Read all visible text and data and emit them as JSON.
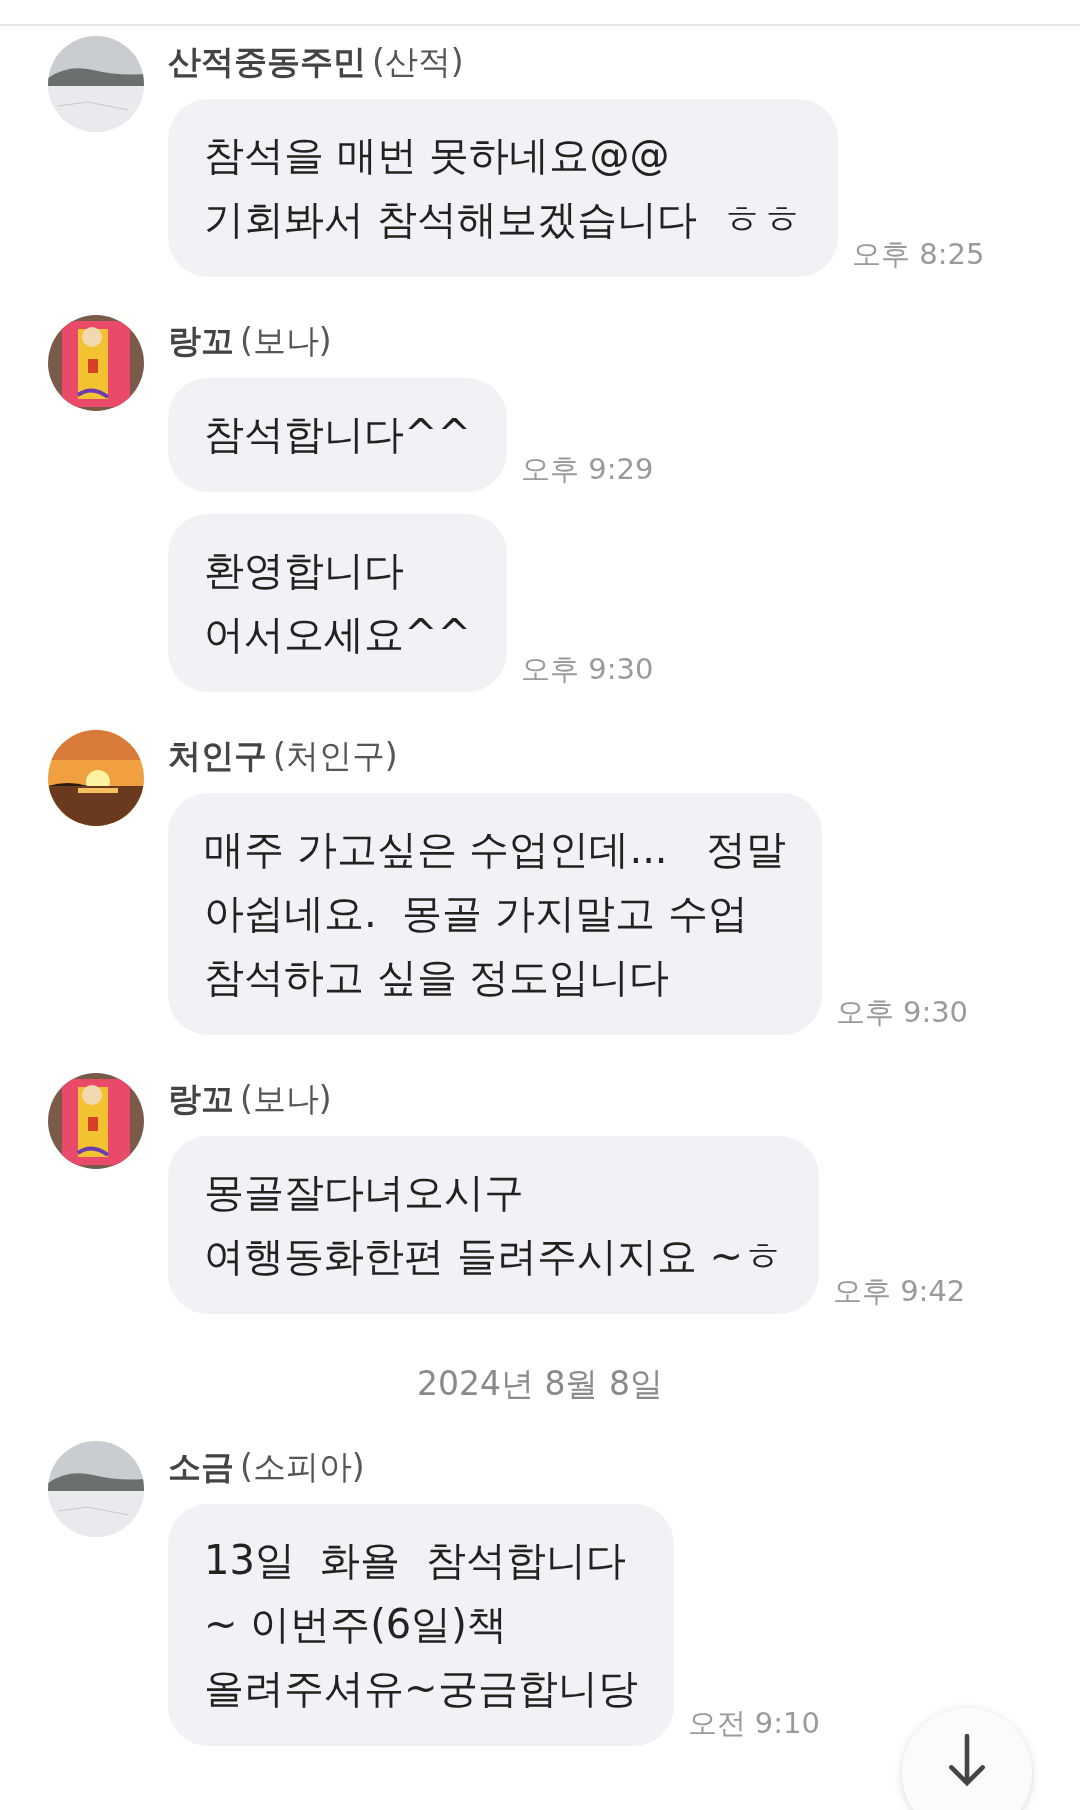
{
  "messages": [
    {
      "kind": "group",
      "name": "산적중동주민",
      "nickname": "(산적)",
      "bubbles": [
        {
          "lines": [
            "참석을 매번 못하네요@@",
            "기회봐서 참석해보겠습니다  ㅎㅎ"
          ],
          "time": "오후 8:25"
        }
      ]
    },
    {
      "kind": "group",
      "name": "랑꼬",
      "nickname": "(보나)",
      "bubbles": [
        {
          "lines": [
            "참석합니다^^"
          ],
          "time": "오후 9:29"
        },
        {
          "lines": [
            "환영합니다",
            "어서오세요^^"
          ],
          "time": "오후 9:30"
        }
      ]
    },
    {
      "kind": "group",
      "name": "처인구",
      "nickname": "(처인구)",
      "bubbles": [
        {
          "lines": [
            "매주 가고싶은 수업인데...   정말",
            "아쉽네요.  몽골 가지말고 수업",
            "참석하고 싶을 정도입니다"
          ],
          "time": "오후 9:30"
        }
      ]
    },
    {
      "kind": "group",
      "name": "랑꼬",
      "nickname": "(보나)",
      "bubbles": [
        {
          "lines": [
            "몽골잘다녀오시구",
            "여행동화한편 들려주시지요 ~ㅎ"
          ],
          "time": "오후 9:42"
        }
      ]
    },
    {
      "kind": "date",
      "text": "2024년 8월 8일"
    },
    {
      "kind": "group",
      "name": "소금",
      "nickname": "(소피아)",
      "bubbles": [
        {
          "lines": [
            "13일  화욜  참석합니다",
            "~ 이번주(6일)책",
            "올려주셔유~궁금합니당"
          ],
          "time": "오전 9:10"
        }
      ]
    }
  ]
}
